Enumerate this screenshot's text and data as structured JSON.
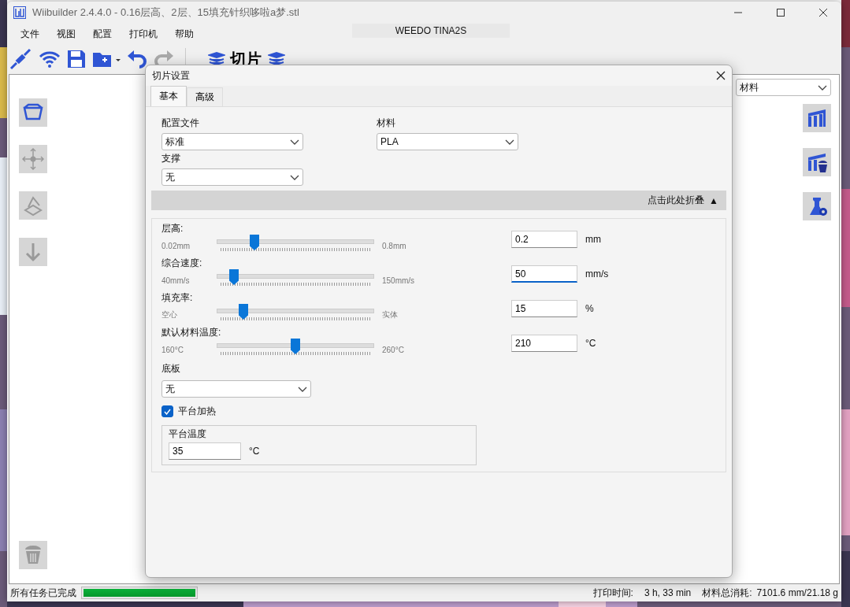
{
  "window": {
    "title": "Wiibuilder 2.4.4.0 - 0.16层高、2层、15填充针织哆啦a梦.stl"
  },
  "menu": [
    "文件",
    "视图",
    "配置",
    "打印机",
    "帮助"
  ],
  "printer": "WEEDO TINA2S",
  "toolbar": {
    "slice_label": "切片"
  },
  "workspace": {
    "view_dropdown": "材料"
  },
  "dialog": {
    "title": "切片设置",
    "tabs": [
      {
        "label": "基本",
        "selected": true
      },
      {
        "label": "高级",
        "selected": false
      }
    ],
    "profile": {
      "label": "配置文件",
      "value": "标准"
    },
    "material": {
      "label": "材料",
      "value": "PLA"
    },
    "support": {
      "label": "支撑",
      "value": "无"
    },
    "collapse_bar": {
      "label": "点击此处折叠",
      "arrow": "▲"
    },
    "sliders": [
      {
        "label": "层高:",
        "min_label": "0.02mm",
        "max_label": "0.8mm",
        "level": 0.24,
        "value": "0.2",
        "unit": "mm",
        "focused": false
      },
      {
        "label": "综合速度:",
        "min_label": "40mm/s",
        "max_label": "150mm/s",
        "level": 0.11,
        "value": "50",
        "unit": "mm/s",
        "focused": true
      },
      {
        "label": "填充率:",
        "min_label": "空心",
        "max_label": "实体",
        "level": 0.17,
        "value": "15",
        "unit": "%",
        "focused": false
      },
      {
        "label": "默认材料温度:",
        "min_label": "160°C",
        "max_label": "260°C",
        "level": 0.5,
        "value": "210",
        "unit": "°C",
        "focused": false
      }
    ],
    "base_plate": {
      "label": "底板",
      "value": "无"
    },
    "bed_heating": {
      "label": "平台加热",
      "checked": true
    },
    "bed_temp": {
      "title": "平台温度",
      "value": "35",
      "unit": "°C"
    }
  },
  "status_bar": {
    "message": "所有任务已完成",
    "level": 1,
    "print_time_label": "打印时间:",
    "print_time": "3 h, 33 min",
    "material_label": "材料总消耗:",
    "material_used": "7101.6 mm/21.18 g"
  }
}
